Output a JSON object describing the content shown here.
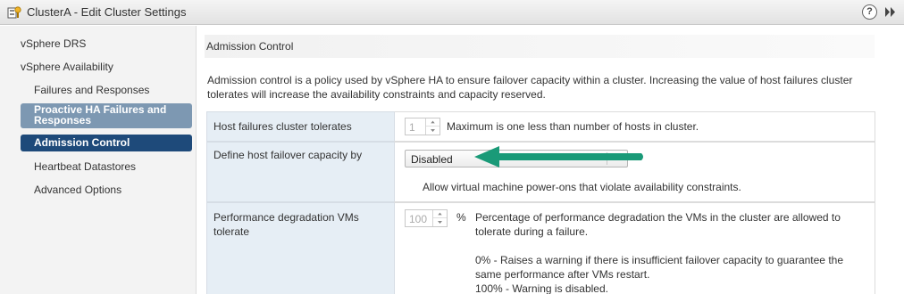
{
  "window": {
    "title": "ClusterA - Edit Cluster Settings",
    "help_label": "?"
  },
  "sidebar": {
    "items": [
      {
        "label": "vSphere DRS"
      },
      {
        "label": "vSphere Availability"
      },
      {
        "label": "Failures and Responses"
      },
      {
        "label": "Proactive HA Failures and Responses"
      },
      {
        "label": "Admission Control"
      },
      {
        "label": "Heartbeat Datastores"
      },
      {
        "label": "Advanced Options"
      }
    ]
  },
  "main": {
    "section_title": "Admission Control",
    "description": "Admission control is a policy used by vSphere HA to ensure failover capacity within a cluster. Increasing the value of host failures cluster tolerates will increase the availability constraints and capacity reserved.",
    "rows": [
      {
        "label": "Host failures cluster tolerates",
        "spinner_value": "1",
        "hint": "Maximum is one less than number of hosts in cluster."
      },
      {
        "label": "Define host failover capacity by",
        "select_value": "Disabled",
        "hint": "Allow virtual machine power-ons that violate availability constraints."
      },
      {
        "label": "Performance degradation VMs tolerate",
        "spinner_value": "100",
        "unit": "%",
        "hint": "Percentage of performance degradation the VMs in the cluster are allowed to tolerate during a failure.",
        "hint2": "0% - Raises a warning if there is insufficient failover capacity to guarantee the same performance after VMs restart.",
        "hint3": "100% - Warning is disabled."
      }
    ]
  },
  "colors": {
    "selected_nav": "#1e4a7a",
    "highlight_nav": "#7d98b2",
    "arrow_annotation": "#1a9a78"
  }
}
